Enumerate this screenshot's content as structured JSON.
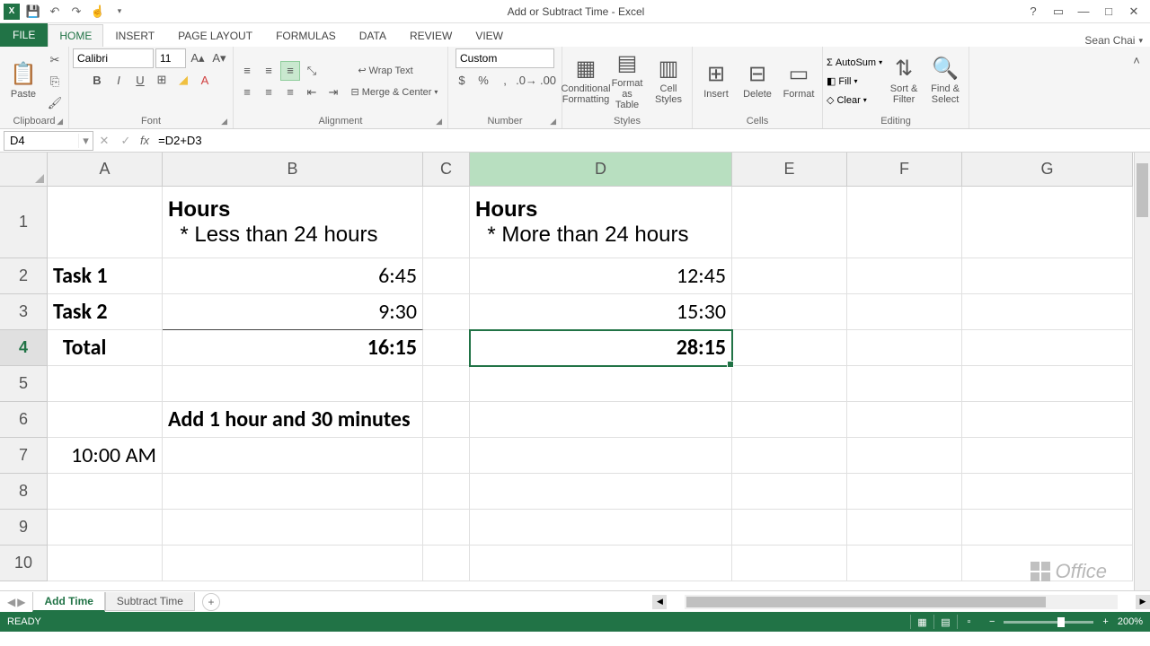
{
  "title": "Add or Subtract Time - Excel",
  "user": "Sean Chai",
  "ribbon_tabs": {
    "file": "FILE",
    "home": "HOME",
    "insert": "INSERT",
    "page_layout": "PAGE LAYOUT",
    "formulas": "FORMULAS",
    "data": "DATA",
    "review": "REVIEW",
    "view": "VIEW"
  },
  "ribbon": {
    "clipboard": {
      "paste": "Paste",
      "label": "Clipboard"
    },
    "font": {
      "name": "Calibri",
      "size": "11",
      "label": "Font"
    },
    "alignment": {
      "wrap": "Wrap Text",
      "merge": "Merge & Center",
      "label": "Alignment"
    },
    "number": {
      "format": "Custom",
      "label": "Number"
    },
    "styles": {
      "cond": "Conditional Formatting",
      "fat": "Format as Table",
      "cell": "Cell Styles",
      "label": "Styles"
    },
    "cells": {
      "insert": "Insert",
      "delete": "Delete",
      "format": "Format",
      "label": "Cells"
    },
    "editing": {
      "autosum": "AutoSum",
      "fill": "Fill",
      "clear": "Clear",
      "sort": "Sort & Filter",
      "find": "Find & Select",
      "label": "Editing"
    }
  },
  "name_box": "D4",
  "formula": "=D2+D3",
  "columns": [
    "A",
    "B",
    "C",
    "D",
    "E",
    "F",
    "G"
  ],
  "rows": [
    "1",
    "2",
    "3",
    "4",
    "5",
    "6",
    "7",
    "8",
    "9",
    "10"
  ],
  "grid": {
    "B1a": "Hours",
    "B1b": "  * Less than 24 hours",
    "D1a": "Hours",
    "D1b": "  * More than 24 hours",
    "A2": "Task 1",
    "B2": "6:45",
    "D2": "12:45",
    "A3": "Task 2",
    "B3": "9:30",
    "D3": "15:30",
    "A4": "  Total",
    "B4": "16:15",
    "D4": "28:15",
    "B6": "Add 1 hour and 30 minutes",
    "A7": "10:00 AM"
  },
  "sheets": {
    "active": "Add Time",
    "other": "Subtract Time"
  },
  "status": {
    "ready": "READY",
    "zoom": "200%"
  }
}
